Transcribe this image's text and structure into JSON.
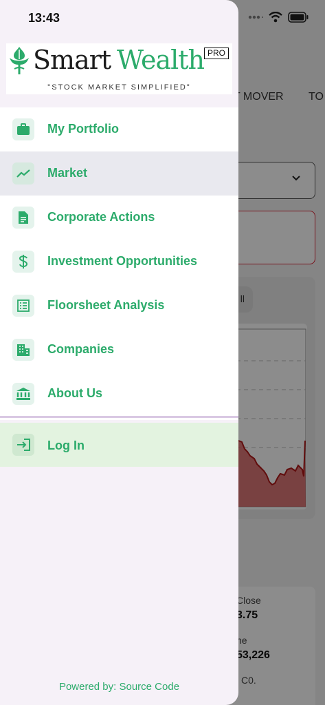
{
  "status_bar": {
    "time": "13:43"
  },
  "background": {
    "tabs": [
      "T MOVER",
      "TO"
    ],
    "chart_tab": "ll",
    "info": [
      {
        "label": "Close",
        "value": "3.75"
      },
      {
        "label": "ne",
        "value": "53,226"
      },
      {
        "label": "l C0.",
        "value": ""
      }
    ]
  },
  "logo": {
    "smart": "Smart",
    "wealth": "Wealth",
    "badge": "PRO",
    "tagline": "\"STOCK MARKET SIMPLIFIED\""
  },
  "menu": {
    "items": [
      {
        "label": "My Portfolio",
        "icon": "briefcase-icon",
        "active": false
      },
      {
        "label": "Market",
        "icon": "trending-up-icon",
        "active": true
      },
      {
        "label": "Corporate Actions",
        "icon": "document-icon",
        "active": false
      },
      {
        "label": "Investment Opportunities",
        "icon": "dollar-icon",
        "active": false
      },
      {
        "label": "Floorsheet Analysis",
        "icon": "list-sheet-icon",
        "active": false
      },
      {
        "label": "Companies",
        "icon": "building-icon",
        "active": false
      },
      {
        "label": "About Us",
        "icon": "bank-icon",
        "active": false
      }
    ],
    "login": {
      "label": "Log In",
      "icon": "login-icon"
    }
  },
  "footer": {
    "text": "Powered by: Source Code"
  },
  "colors": {
    "accent": "#2cab6b",
    "active_bg": "#e9e9ef",
    "login_bg": "#e3f3e0",
    "drawer_bg": "#f6f1f8"
  }
}
